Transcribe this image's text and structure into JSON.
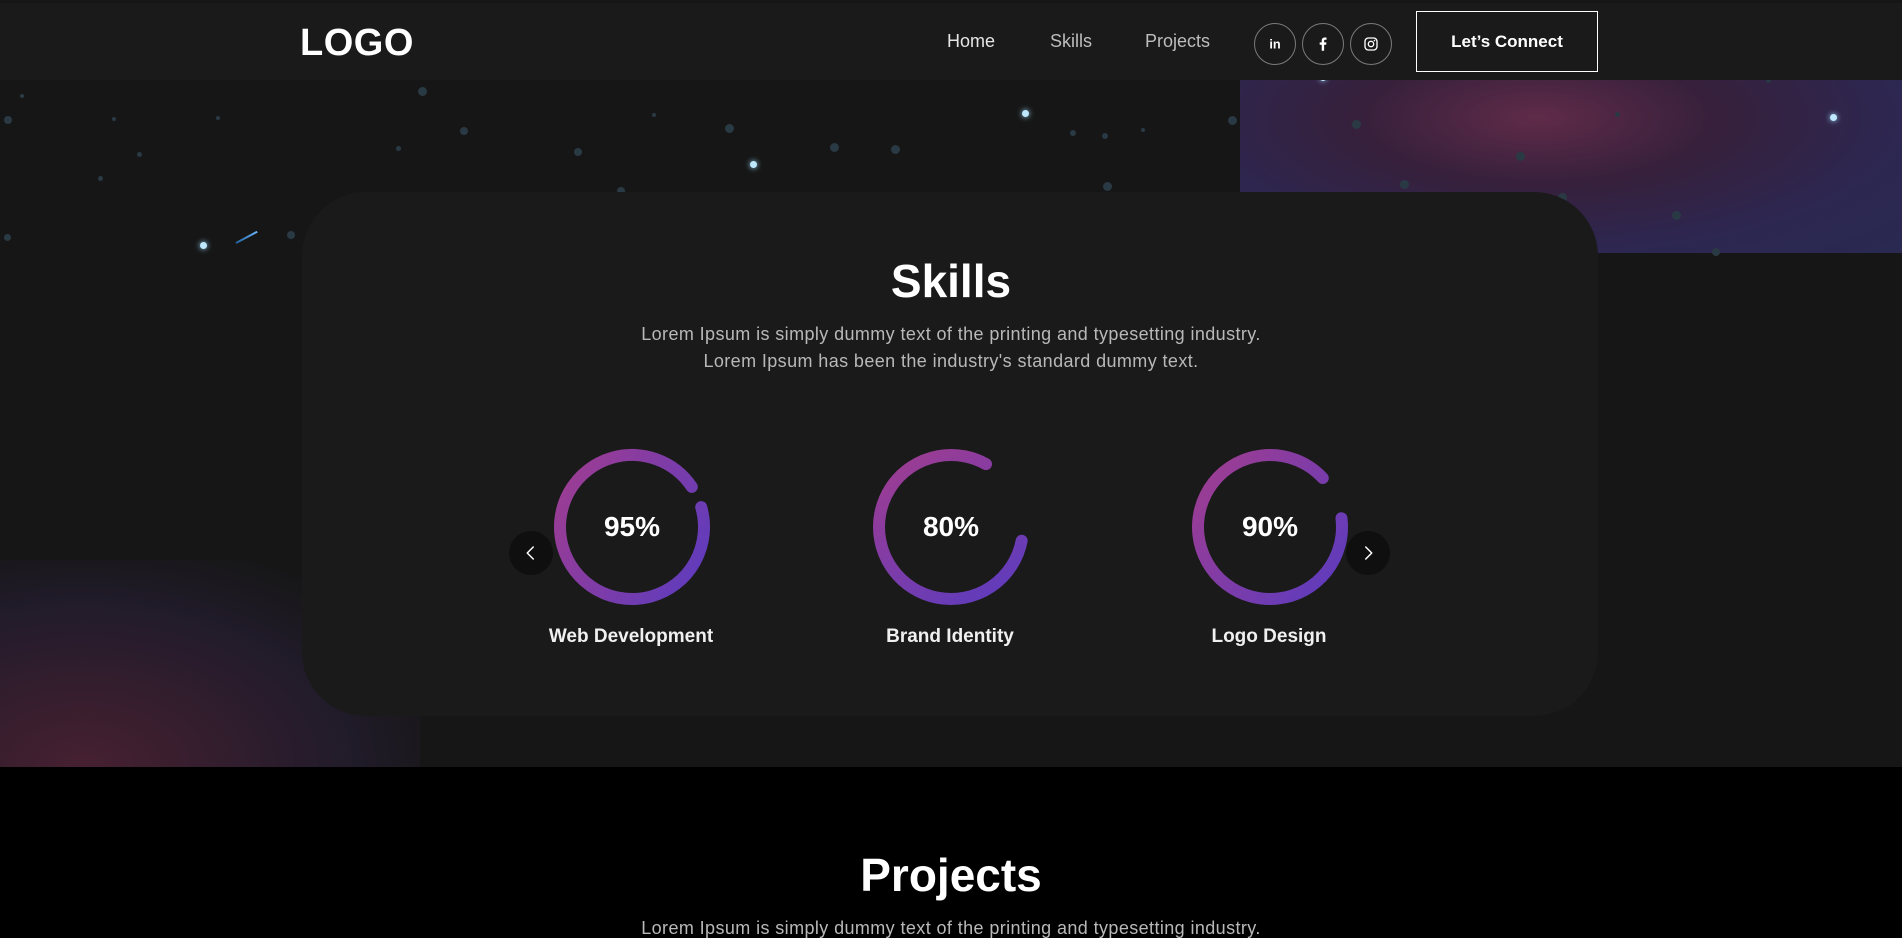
{
  "header": {
    "logo": "LOGO",
    "nav": [
      {
        "label": "Home"
      },
      {
        "label": "Skills"
      },
      {
        "label": "Projects"
      }
    ],
    "social": [
      {
        "icon": "linkedin-icon"
      },
      {
        "icon": "facebook-icon"
      },
      {
        "icon": "instagram-icon"
      }
    ],
    "connect_label": "Let’s Connect"
  },
  "skills": {
    "title": "Skills",
    "description_line1": "Lorem Ipsum is simply dummy text of the printing and typesetting industry.",
    "description_line2": "Lorem Ipsum has been the industry's standard dummy text.",
    "items": [
      {
        "name": "Web Development",
        "percent_label": "95%",
        "percent": 95
      },
      {
        "name": "Brand Identity",
        "percent_label": "80%",
        "percent": 80
      },
      {
        "name": "Logo Design",
        "percent_label": "90%",
        "percent": 90
      }
    ],
    "prev_icon": "chevron-left-icon",
    "next_icon": "chevron-right-icon"
  },
  "projects": {
    "title": "Projects",
    "description_line1": "Lorem Ipsum is simply dummy text of the printing and typesetting industry."
  },
  "colors": {
    "ring_start": "#a23d8f",
    "ring_end": "#5a3bc0",
    "background": "#161616",
    "card": "#1a1a1a",
    "projects_bg": "#000000"
  }
}
